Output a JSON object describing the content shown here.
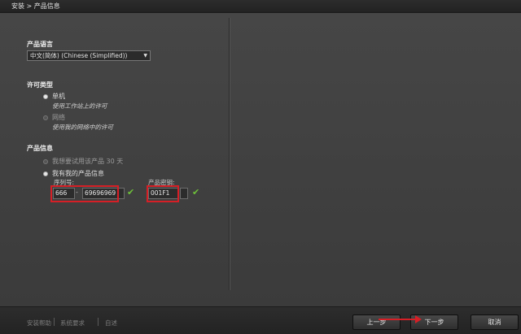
{
  "titlebar": {
    "breadcrumb": "安装 > 产品信息"
  },
  "language": {
    "title": "产品语言",
    "selected": "中文(简体) (Chinese (Simplified))"
  },
  "license_type": {
    "title": "许可类型",
    "options": [
      {
        "label": "单机",
        "description": "使用工作站上的许可",
        "selected": true
      },
      {
        "label": "网络",
        "description": "使用我的网络中的许可",
        "selected": false
      }
    ]
  },
  "product_info": {
    "title": "产品信息",
    "trial_label": "我想要试用该产品 30 天",
    "have_info_label": "我有我的产品信息",
    "serial_label": "序列号:",
    "serial_part1": "666",
    "serial_separator": "-",
    "serial_part2": "69696969",
    "key_label": "产品密钥:",
    "key_value": "001F1"
  },
  "footer": {
    "links": [
      "安装帮助",
      "系统要求",
      "自述"
    ],
    "back_button": "上一步",
    "next_button": "下一步",
    "cancel_button": "取消"
  },
  "colors": {
    "highlight": "#d61f26",
    "valid_check": "#6ec13a"
  }
}
